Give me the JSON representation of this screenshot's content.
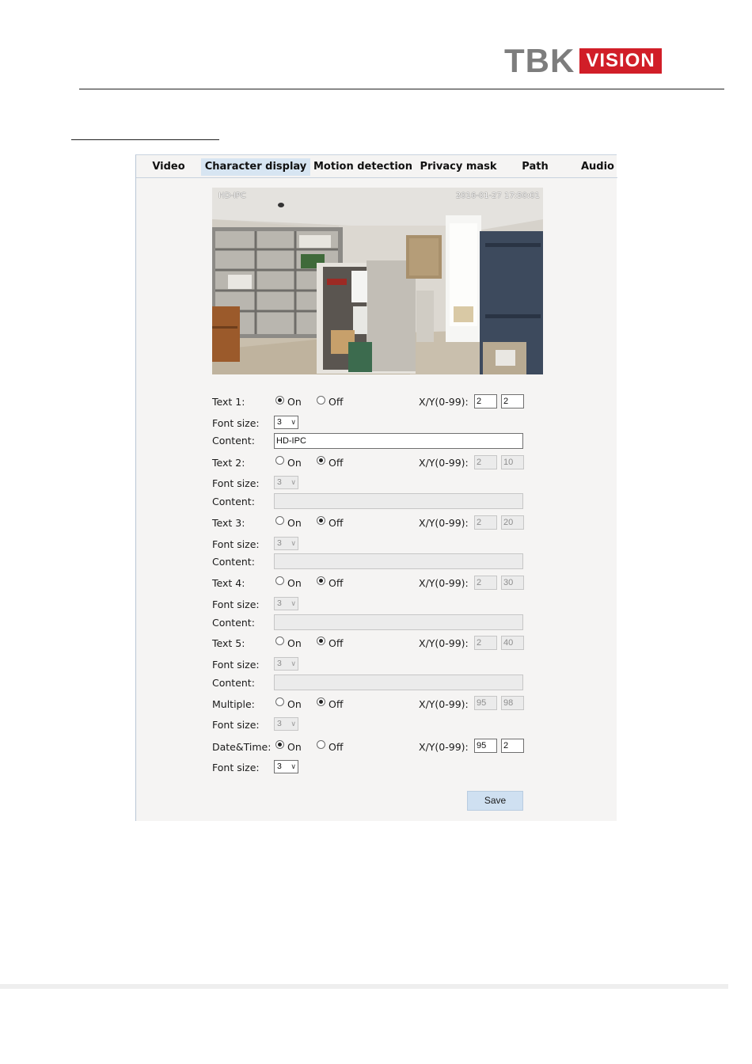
{
  "brand": {
    "name_part1": "TBK",
    "name_part2": "VISION"
  },
  "tabs": [
    {
      "label": "Video",
      "active": false
    },
    {
      "label": "Character display",
      "active": true
    },
    {
      "label": "Motion detection",
      "active": false
    },
    {
      "label": "Privacy mask",
      "active": false
    },
    {
      "label": "Path",
      "active": false
    },
    {
      "label": "Audio",
      "active": false
    }
  ],
  "preview": {
    "osd_name": "HD-IPC",
    "osd_datetime": "2016-01-27  17:50:01"
  },
  "labels": {
    "on": "On",
    "off": "Off",
    "xy": "X/Y(0-99):",
    "font_size": "Font size:",
    "content": "Content:"
  },
  "rows": [
    {
      "label": "Text 1:",
      "state": "On",
      "x": "2",
      "y": "2",
      "font_size": "3",
      "content": "HD-IPC",
      "enabled": true
    },
    {
      "label": "Text 2:",
      "state": "Off",
      "x": "2",
      "y": "10",
      "font_size": "3",
      "content": "",
      "enabled": false
    },
    {
      "label": "Text 3:",
      "state": "Off",
      "x": "2",
      "y": "20",
      "font_size": "3",
      "content": "",
      "enabled": false
    },
    {
      "label": "Text 4:",
      "state": "Off",
      "x": "2",
      "y": "30",
      "font_size": "3",
      "content": "",
      "enabled": false
    },
    {
      "label": "Text 5:",
      "state": "Off",
      "x": "2",
      "y": "40",
      "font_size": "3",
      "content": "",
      "enabled": false
    },
    {
      "label": "Multiple:",
      "state": "Off",
      "x": "95",
      "y": "98",
      "font_size": "3",
      "enabled": false
    },
    {
      "label": "Date&Time:",
      "state": "On",
      "x": "95",
      "y": "2",
      "font_size": "3",
      "enabled": true
    }
  ],
  "save_label": "Save",
  "colors": {
    "tab_active": "#d7e5f2",
    "panel_bg": "#f5f4f3",
    "save_button": "#cfe0f1",
    "brand_red": "#d11e28",
    "brand_gray": "#7d7d7d"
  }
}
